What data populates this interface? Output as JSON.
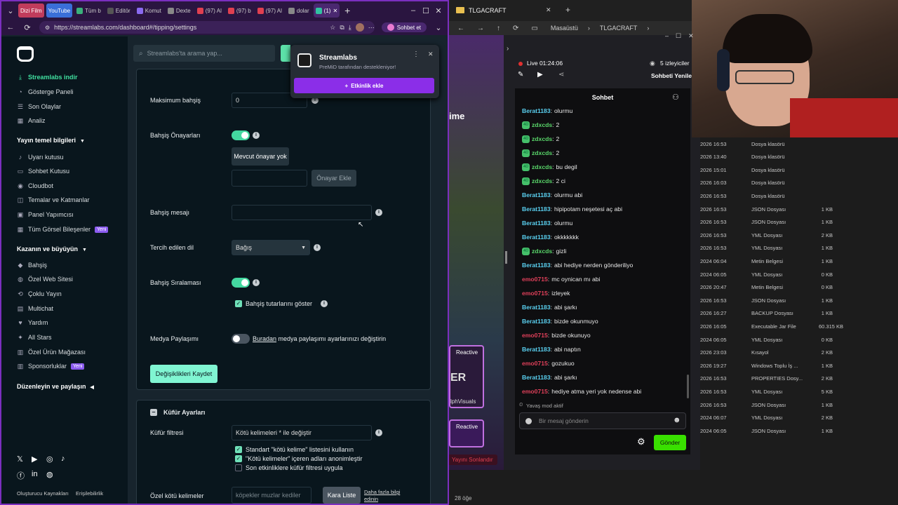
{
  "browser": {
    "tabs": [
      {
        "label": "Dizi Film",
        "pill": "red"
      },
      {
        "label": "YouTube",
        "pill": "blue"
      },
      {
        "label": "Tüm b",
        "color": "#3ab07a"
      },
      {
        "label": "Editör",
        "color": "#555"
      },
      {
        "label": "Komut",
        "color": "#8a6af0"
      },
      {
        "label": "Dexte",
        "color": "#888"
      },
      {
        "label": "(97) Al",
        "color": "#e04050"
      },
      {
        "label": "(97) b",
        "color": "#e04050"
      },
      {
        "label": "(97) Al",
        "color": "#e04050"
      },
      {
        "label": "dolar",
        "color": "#888"
      },
      {
        "label": "(1)",
        "color": "#31c3a2",
        "active": true
      }
    ],
    "url": "https://streamlabs.com/dashboard#/tipping/settings",
    "sync_label": "Sohbet et"
  },
  "sidebar": {
    "items_top": [
      "Streamlabs indir",
      "Gösterge Paneli",
      "Son Olaylar",
      "Analiz"
    ],
    "section1": "Yayın temel bilgileri",
    "items_mid": [
      "Uyarı kutusu",
      "Sohbet Kutusu",
      "Cloudbot",
      "Temalar ve Katmanlar",
      "Panel Yapımcısı",
      "Tüm Görsel Bileşenler"
    ],
    "badge_new": "Yeni",
    "section2": "Kazanın ve büyüyün",
    "items_earn": [
      "Bahşiş",
      "Özel Web Sitesi",
      "Çoklu Yayın",
      "Multichat",
      "Yardım",
      "All Stars",
      "Özel Ürün Mağazası",
      "Sponsorluklar"
    ],
    "section3": "Düzenleyin ve paylaşın",
    "footer_links": [
      "Oluşturucu Kaynakları",
      "Erişilebilirlik"
    ]
  },
  "search": {
    "placeholder": "Streamlabs'ta arama yap..."
  },
  "popup": {
    "title": "Streamlabs",
    "subtitle": "PreMiD tarafından destekleniyor!",
    "button": "Etkinlik ekle"
  },
  "settings": {
    "max_tip_label": "Maksimum bahşiş",
    "max_tip_value": "0",
    "presets_label": "Bahşiş Önayarları",
    "no_presets": "Mevcut önayar yok",
    "add_preset": "Önayar Ekle",
    "tip_message_label": "Bahşiş mesajı",
    "language_label": "Tercih edilen dil",
    "language_value": "Bağış",
    "ranking_label": "Bahşiş Sıralaması",
    "show_amounts": "Bahşiş tutarlarını göster",
    "media_label": "Medya Paylaşımı",
    "media_link": "Buradan",
    "media_text": " medya paylaşımı ayarlarınızı değiştirin",
    "save_button": "Değişiklikleri Kaydet"
  },
  "profanity": {
    "title": "Küfür Ayarları",
    "filter_label": "Küfür filtresi",
    "filter_value": "Kötü kelimeleri * ile değiştir",
    "opt1": "Standart \"kötü kelime\" listesini kullanın",
    "opt2": "\"Kötü kelimeler\" içeren adları anonimleştir",
    "opt3": "Son etkinliklere küfür filtresi uygula",
    "custom_label": "Özel kötü kelimeler",
    "custom_placeholder": "köpekler muzlar kediler",
    "blacklist_button": "Kara Liste",
    "more_info": "Daha fazla bilgi edinin"
  },
  "explorer": {
    "window_title": "TLGACRAFT",
    "breadcrumb": [
      "Masaüstü",
      "TLGACRAFT"
    ],
    "status": "28 öğe"
  },
  "stream": {
    "live_time": "Live 01:24:06",
    "viewers": "5 izleyiciler",
    "refresh": "Sohbeti Yenile",
    "chat_title": "Sohbet",
    "slow_mode": "Yavaş mod aktif",
    "input_placeholder": "Bir mesaj gönderin",
    "send": "Gönder",
    "game_title": "ime",
    "reactive1": "Reactive",
    "reactive2": "Reactive",
    "card_text": "ER",
    "card_sub": "lphVisuals",
    "end_stream": "Yayını Sonlandır"
  },
  "chat": [
    {
      "user": "Berat1183",
      "cls": "u1",
      "text": "olurmu",
      "mod": false
    },
    {
      "user": "zdxcds",
      "cls": "u2",
      "text": "2",
      "mod": true
    },
    {
      "user": "zdxcds",
      "cls": "u2",
      "text": "2",
      "mod": true
    },
    {
      "user": "zdxcds",
      "cls": "u2",
      "text": "2",
      "mod": true
    },
    {
      "user": "zdxcds",
      "cls": "u2",
      "text": "bu degil",
      "mod": true
    },
    {
      "user": "zdxcds",
      "cls": "u2",
      "text": "2 ci",
      "mod": true
    },
    {
      "user": "Berat1183",
      "cls": "u1",
      "text": "olurmu abi",
      "mod": false
    },
    {
      "user": "Berat1183",
      "cls": "u1",
      "text": "hipipotam neşetesi aç abi",
      "mod": false
    },
    {
      "user": "Berat1183",
      "cls": "u1",
      "text": "olurmu",
      "mod": false
    },
    {
      "user": "Berat1183",
      "cls": "u1",
      "text": "okkkkkkk",
      "mod": false
    },
    {
      "user": "zdxcds",
      "cls": "u2",
      "text": "gizli",
      "mod": true
    },
    {
      "user": "Berat1183",
      "cls": "u1",
      "text": "abi hediye nerden gönderiliyo",
      "mod": false
    },
    {
      "user": "emo0715",
      "cls": "u3",
      "text": "mc oynican mı abi",
      "mod": false
    },
    {
      "user": "emo0715",
      "cls": "u3",
      "text": "izleyek",
      "mod": false
    },
    {
      "user": "Berat1183",
      "cls": "u1",
      "text": "abi şarkı",
      "mod": false
    },
    {
      "user": "Berat1183",
      "cls": "u1",
      "text": "bizde okunmuyo",
      "mod": false
    },
    {
      "user": "emo0715",
      "cls": "u3",
      "text": "bizde okunuyo",
      "mod": false
    },
    {
      "user": "Berat1183",
      "cls": "u1",
      "text": "abi naptın",
      "mod": false
    },
    {
      "user": "emo0715",
      "cls": "u3",
      "text": "gozukuo",
      "mod": false
    },
    {
      "user": "Berat1183",
      "cls": "u1",
      "text": "abi şarkı",
      "mod": false
    },
    {
      "user": "emo0715",
      "cls": "u3",
      "text": "hediye atma yeri yok nedense abi",
      "mod": false
    }
  ],
  "mod_badge": "40",
  "files": [
    [
      "2026 16:53",
      "Dosya klasörü",
      ""
    ],
    [
      "2026 13:40",
      "Dosya klasörü",
      ""
    ],
    [
      "2026 15:01",
      "Dosya klasörü",
      ""
    ],
    [
      "2026 16:03",
      "Dosya klasörü",
      ""
    ],
    [
      "2026 16:53",
      "Dosya klasörü",
      ""
    ],
    [
      "2026 16:53",
      "JSON Dosyası",
      "1 KB"
    ],
    [
      "2026 16:53",
      "JSON Dosyası",
      "1 KB"
    ],
    [
      "2026 16:53",
      "YML Dosyası",
      "2 KB"
    ],
    [
      "2026 16:53",
      "YML Dosyası",
      "1 KB"
    ],
    [
      "2024 06:04",
      "Metin Belgesi",
      "1 KB"
    ],
    [
      "2024 06:05",
      "YML Dosyası",
      "0 KB"
    ],
    [
      "2026 20:47",
      "Metin Belgesi",
      "0 KB"
    ],
    [
      "2026 16:53",
      "JSON Dosyası",
      "1 KB"
    ],
    [
      "2026 16:27",
      "BACKUP Dosyası",
      "1 KB"
    ],
    [
      "2026 16:05",
      "Executable Jar File",
      "60.315 KB"
    ],
    [
      "2024 06:05",
      "YML Dosyası",
      "0 KB"
    ],
    [
      "2026 23:03",
      "Kısayol",
      "2 KB"
    ],
    [
      "2026 19:27",
      "Windows Toplu İş ...",
      "1 KB"
    ],
    [
      "2026 16:53",
      "PROPERTIES Dosy...",
      "2 KB"
    ],
    [
      "2026 16:53",
      "YML Dosyası",
      "5 KB"
    ],
    [
      "2026 16:53",
      "JSON Dosyası",
      "1 KB"
    ],
    [
      "2024 06:07",
      "YML Dosyası",
      "2 KB"
    ],
    [
      "2024 06:05",
      "JSON Dosyası",
      "1 KB"
    ]
  ]
}
